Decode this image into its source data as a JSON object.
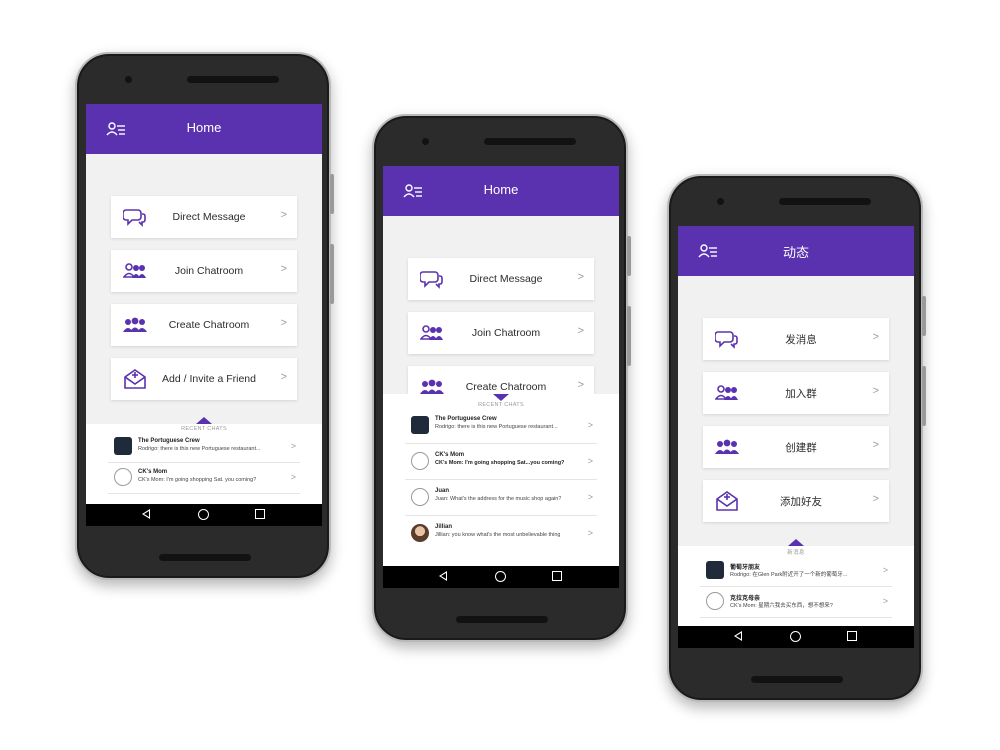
{
  "brand_color": "#5a32b0",
  "phones": [
    {
      "title": "Home",
      "menu": [
        {
          "label": "Direct Message",
          "icon": "chat-bubbles-icon"
        },
        {
          "label": "Join Chatroom",
          "icon": "join-group-icon"
        },
        {
          "label": "Create Chatroom",
          "icon": "group-icon"
        },
        {
          "label": "Add / Invite a Friend",
          "icon": "invite-envelope-icon"
        }
      ],
      "recent_label": "RECENT CHATS",
      "chats": [
        {
          "name": "The Portuguese Crew",
          "message": "Rodrigo: there is this new Portuguese restaurant..."
        },
        {
          "name": "CK's Mom",
          "message": "CK's Mom: I'm going shopping Sat. you coming?"
        }
      ]
    },
    {
      "title": "Home",
      "menu": [
        {
          "label": "Direct Message",
          "icon": "chat-bubbles-icon"
        },
        {
          "label": "Join Chatroom",
          "icon": "join-group-icon"
        },
        {
          "label": "Create Chatroom",
          "icon": "group-icon"
        }
      ],
      "recent_label": "RECENT CHATS",
      "chats": [
        {
          "name": "The Portuguese Crew",
          "message": "Rodrigo: there is this new Portuguese restaurant..."
        },
        {
          "name": "CK's Mom",
          "message": "CK's Mom: I'm going shopping Sat...you coming?"
        },
        {
          "name": "Juan",
          "message": "Juan: What's the address for the music shop again?"
        },
        {
          "name": "Jillian",
          "message": "Jillian: you know what's the most unbelievable thing"
        }
      ]
    },
    {
      "title": "动态",
      "menu": [
        {
          "label": "发消息",
          "icon": "chat-bubbles-icon"
        },
        {
          "label": "加入群",
          "icon": "join-group-icon"
        },
        {
          "label": "创建群",
          "icon": "group-icon"
        },
        {
          "label": "添加好友",
          "icon": "invite-envelope-icon"
        }
      ],
      "recent_label": "新消息",
      "chats": [
        {
          "name": "葡萄牙朋友",
          "message": "Rodrigo: 在Glen Park附近开了一个新的葡萄牙..."
        },
        {
          "name": "克拉克母亲",
          "message": "CK's Mom: 星期六我去买东西，想不想来?"
        }
      ]
    }
  ]
}
